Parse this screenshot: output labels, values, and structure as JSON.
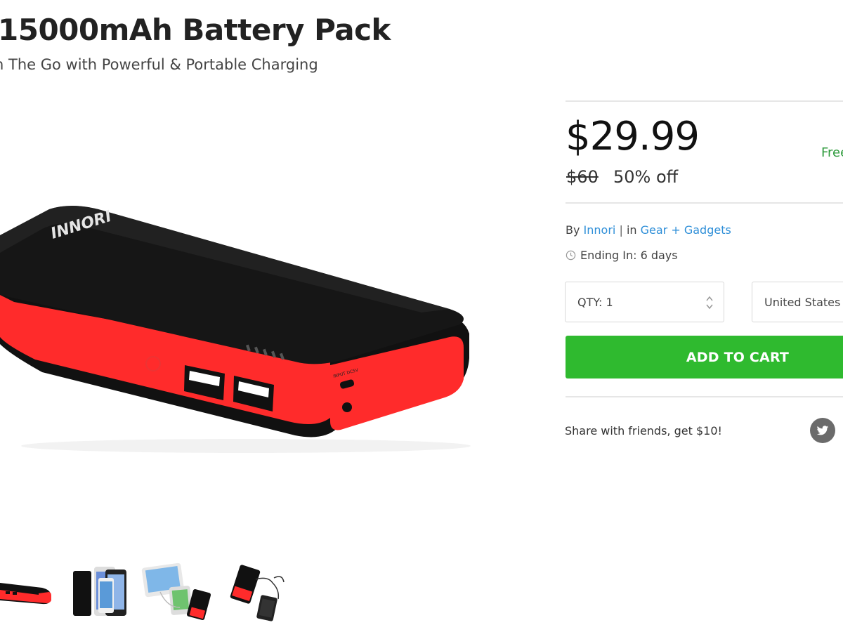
{
  "product": {
    "title": "15000mAh Battery Pack",
    "subtitle": "n The Go with Powerful & Portable Charging",
    "brand_logo_text": "INNORI"
  },
  "pricing": {
    "price": "$29.99",
    "retail_price": "$60",
    "discount": "50% off",
    "shipping_text": "Free"
  },
  "meta": {
    "by_label": "By",
    "vendor": "Innori",
    "separator": "|",
    "in_label": "in",
    "category": "Gear + Gadgets",
    "ending_label": "Ending In: 6 days"
  },
  "purchase": {
    "qty_label": "QTY: 1",
    "country": "United States",
    "add_to_cart": "ADD TO CART"
  },
  "share": {
    "text": "Share with friends, get $10!",
    "icons": [
      "twitter-icon"
    ]
  },
  "thumbnails": [
    "battery-pack-red",
    "battery-with-phones",
    "battery-charging-devices",
    "battery-with-cable"
  ],
  "colors": {
    "accent_green": "#2fba2f",
    "link_blue": "#2f8fd8",
    "shipping_green": "#2d9a3b",
    "product_red": "#ff2b2b"
  }
}
